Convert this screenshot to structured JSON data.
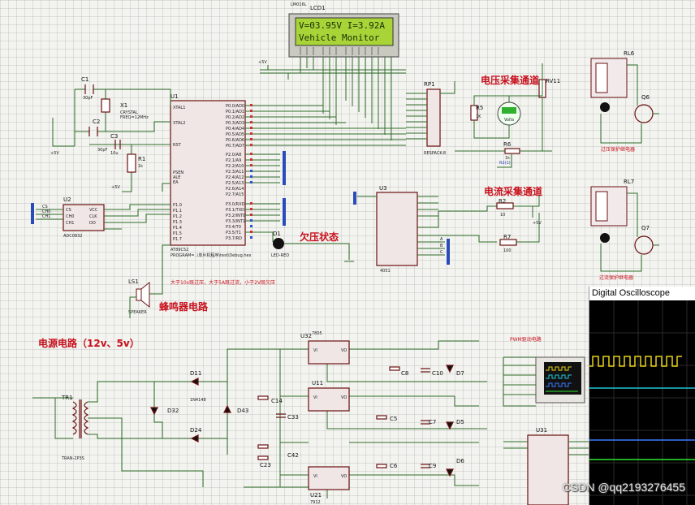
{
  "lcd": {
    "ref": "LCD1",
    "model": "LM016L",
    "line1": "V=03.95V I=3.92A",
    "line2": "Vehicle  Monitor"
  },
  "components": {
    "u1": "U1",
    "u1_part": "AT89C52",
    "u1_program": "PROGRAM=..\\单片机程序\\test\\Debug.hex",
    "u2": "U2",
    "u2_part": "ADC0832",
    "u3": "U3",
    "u3_part": "4051",
    "u11": "U11",
    "u21": "U21",
    "u21_part": "7912",
    "u31": "U31",
    "u32": "U32",
    "u32_part": "7805",
    "rp1": "RP1",
    "rp1_part": "RESPACK-8",
    "rv11": "RV11",
    "r5": "R5",
    "r5_val": "1K",
    "r6": "R6",
    "r6_val": "1k",
    "r2": "R2",
    "r2_val": "10",
    "r7": "R7",
    "r7_val": "100",
    "r1": "R1",
    "r1_val": "1k",
    "c1": "C1",
    "c1_val": "30pF",
    "c2": "C2",
    "c2_val": "30pF",
    "c3": "C3",
    "c3_val": "10u",
    "x1": "X1",
    "x1_desc": "CRYSTAL",
    "x1_freq": "FREQ=12MHz",
    "q6": "Q6",
    "q7": "Q7",
    "rl6": "RL6",
    "rl7": "RL7",
    "d1": "D1",
    "d1_part": "LED-RED",
    "ls1": "LS1",
    "ls1_part": "SPEAKER",
    "tr1": "TR1",
    "tr1_part": "TRAN-2P3S",
    "d11": "D11",
    "d32": "D32",
    "d24": "D24",
    "d43": "D43",
    "diode_part": "1N4148",
    "c8": "C8",
    "c10": "C10",
    "c14": "C14",
    "c33": "C33",
    "c42": "C42",
    "c23": "C23",
    "c5": "C5",
    "c7": "C7",
    "c6": "C6",
    "c9": "C9",
    "d7": "D7",
    "d5": "D5",
    "d6": "D6",
    "vm": "Volts",
    "vcc5": "+5V"
  },
  "labels": {
    "voltage_channel": "电压采集通道",
    "current_channel": "电流采集通道",
    "undervoltage": "欠压状态",
    "buzzer": "蜂鸣器电路",
    "power": "电源电路（12v、5v）",
    "overvoltage_relay": "过压保护继电器",
    "overcurrent_relay": "过流保护继电器",
    "pwm": "PWM驱动电路",
    "note": "大于10v既过压，大于5A既过流，小于2V既欠压"
  },
  "oscilloscope": {
    "title": "Digital Oscilloscope",
    "trace_colors": [
      "#e8d21a",
      "#1ec6d6",
      "#3c7bff",
      "#2ee82e"
    ]
  },
  "watermark": "CSDN @qq2193276455"
}
